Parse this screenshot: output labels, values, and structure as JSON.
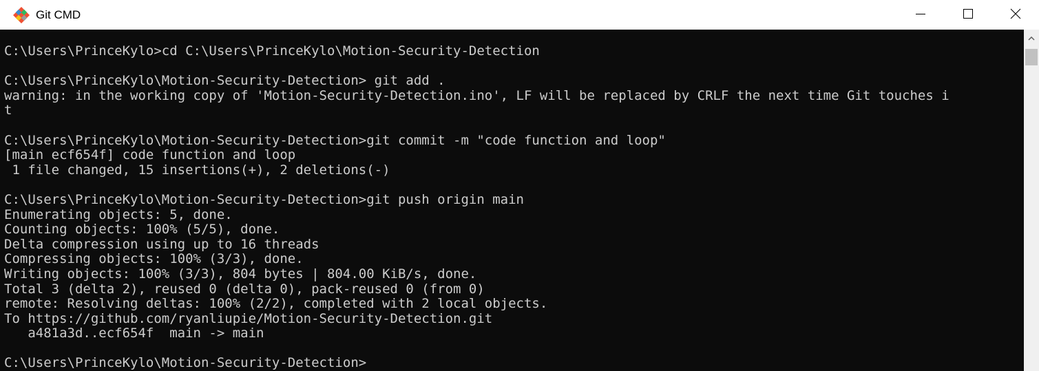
{
  "window": {
    "title": "Git CMD",
    "app_icon": "git-logo-icon",
    "controls": {
      "minimize_icon": "minimize-icon",
      "maximize_icon": "maximize-icon",
      "close_icon": "close-icon"
    }
  },
  "terminal": {
    "background": "#0c0c0c",
    "foreground": "#cccccc",
    "lines": [
      "C:\\Users\\PrinceKylo>cd C:\\Users\\PrinceKylo\\Motion-Security-Detection",
      "",
      "C:\\Users\\PrinceKylo\\Motion-Security-Detection> git add .",
      "warning: in the working copy of 'Motion-Security-Detection.ino', LF will be replaced by CRLF the next time Git touches i",
      "t",
      "",
      "C:\\Users\\PrinceKylo\\Motion-Security-Detection>git commit -m \"code function and loop\"",
      "[main ecf654f] code function and loop",
      " 1 file changed, 15 insertions(+), 2 deletions(-)",
      "",
      "C:\\Users\\PrinceKylo\\Motion-Security-Detection>git push origin main",
      "Enumerating objects: 5, done.",
      "Counting objects: 100% (5/5), done.",
      "Delta compression using up to 16 threads",
      "Compressing objects: 100% (3/3), done.",
      "Writing objects: 100% (3/3), 804 bytes | 804.00 KiB/s, done.",
      "Total 3 (delta 2), reused 0 (delta 0), pack-reused 0 (from 0)",
      "remote: Resolving deltas: 100% (2/2), completed with 2 local objects.",
      "To https://github.com/ryanliupie/Motion-Security-Detection.git",
      "   a481a3d..ecf654f  main -> main",
      "",
      "C:\\Users\\PrinceKylo\\Motion-Security-Detection>"
    ]
  },
  "scrollbar": {
    "up_icon": "scroll-up-arrow-icon"
  }
}
